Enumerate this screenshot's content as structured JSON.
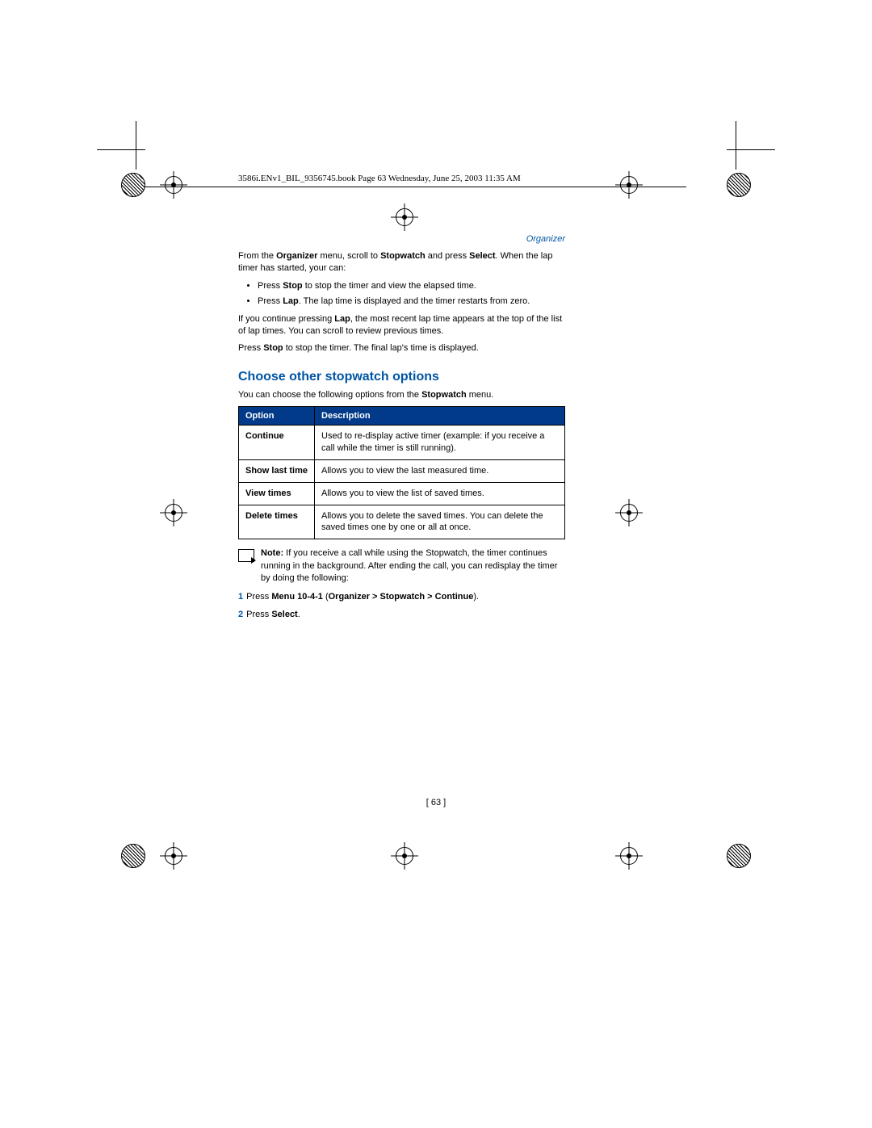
{
  "header_line": "3586i.ENv1_BIL_9356745.book  Page 63  Wednesday, June 25, 2003  11:35 AM",
  "section_label": "Organizer",
  "intro": {
    "prefix": "From the ",
    "b1": "Organizer",
    "mid1": " menu, scroll to ",
    "b2": "Stopwatch",
    "mid2": " and press ",
    "b3": "Select",
    "suffix": ". When the lap timer has started, your can:"
  },
  "bullet1": {
    "pre": "Press ",
    "b": "Stop",
    "post": " to stop the timer and view the elapsed time."
  },
  "bullet2": {
    "pre": "Press ",
    "b": "Lap",
    "post": ". The lap time is displayed and the timer restarts from zero."
  },
  "para_lap": {
    "pre": "If you continue pressing ",
    "b": "Lap",
    "post": ", the most recent lap time appears at the top of the list of lap times. You can scroll to review previous times."
  },
  "para_stop": {
    "pre": "Press ",
    "b": "Stop",
    "post": " to stop the timer. The final lap's time is displayed."
  },
  "heading": "Choose other stopwatch options",
  "subtext": {
    "pre": "You can choose the following options from the ",
    "b": "Stopwatch",
    "post": " menu."
  },
  "table": {
    "h1": "Option",
    "h2": "Description",
    "rows": [
      {
        "opt": "Continue",
        "desc": "Used to re-display active timer (example: if you receive a call while the timer is still running)."
      },
      {
        "opt": "Show last time",
        "desc": "Allows you to view the last measured time."
      },
      {
        "opt": "View times",
        "desc": "Allows you to view the list of saved times."
      },
      {
        "opt": "Delete times",
        "desc": "Allows you to delete the saved times. You can delete the saved times one by one or all at once."
      }
    ]
  },
  "note": {
    "label": "Note:",
    "text": " If you receive a call while using the Stopwatch, the timer continues running in the background. After ending the call, you can redisplay the timer by doing the following:"
  },
  "steps": [
    {
      "num": "1",
      "pre": "Press ",
      "b": "Menu 10-4-1",
      "mid": " (",
      "b2": "Organizer > Stopwatch > Continue",
      "post": ")."
    },
    {
      "num": "2",
      "pre": "Press ",
      "b": "Select",
      "post": "."
    }
  ],
  "page_number": "[ 63 ]"
}
